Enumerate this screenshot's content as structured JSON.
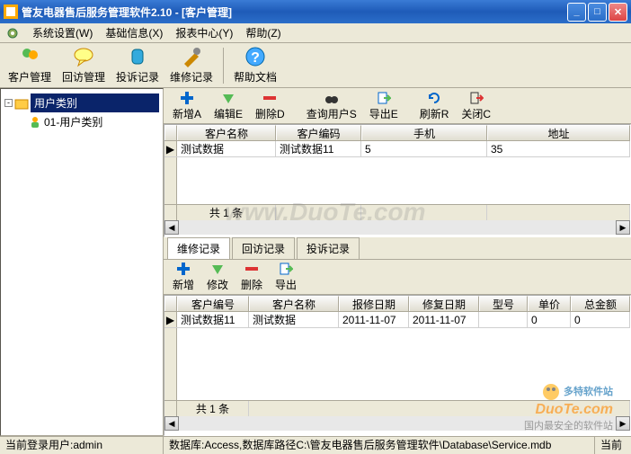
{
  "window": {
    "title": "管友电器售后服务管理软件2.10 - [客户管理]"
  },
  "menu": {
    "system": "系统设置(W)",
    "basic": "基础信息(X)",
    "report": "报表中心(Y)",
    "help": "帮助(Z)"
  },
  "mainToolbar": {
    "customer": "客户管理",
    "visit": "回访管理",
    "complaint": "投诉记录",
    "repair": "维修记录",
    "helpdoc": "帮助文档"
  },
  "tree": {
    "root": "用户类别",
    "child": "01-用户类别"
  },
  "topTool": {
    "add": "新增A",
    "edit": "编辑E",
    "del": "删除D",
    "search": "查询用户S",
    "export": "导出E",
    "refresh": "刷新R",
    "close": "关闭C"
  },
  "topGrid": {
    "cols": {
      "name": "客户名称",
      "code": "客户编码",
      "phone": "手机",
      "addr": "地址"
    },
    "row": {
      "name": "测试数据",
      "code": "测试数据11",
      "phone": "5",
      "addr": "35"
    },
    "foot": "共 1 条"
  },
  "tabs": {
    "repair": "维修记录",
    "visit": "回访记录",
    "complaint": "投诉记录"
  },
  "botTool": {
    "add": "新增",
    "edit": "修改",
    "del": "删除",
    "export": "导出"
  },
  "botGrid": {
    "cols": {
      "code": "客户编号",
      "name": "客户名称",
      "repdate": "报修日期",
      "fixdate": "修复日期",
      "model": "型号",
      "price": "单价",
      "total": "总金额"
    },
    "row": {
      "code": "测试数据11",
      "name": "测试数据",
      "repdate": "2011-11-07",
      "fixdate": "2011-11-07",
      "model": "",
      "price": "0",
      "total": "0"
    },
    "foot": "共 1 条"
  },
  "status": {
    "user": "当前登录用户:admin",
    "db": "数据库:Access,数据库路径C:\\管友电器售后服务管理软件\\Database\\Service.mdb",
    "time": "当前"
  },
  "watermark": "www.DuoTe.com",
  "watermark2": {
    "brand": "多特软件站",
    "domain": "DuoTe.com",
    "tag": "国内最安全的软件站"
  }
}
